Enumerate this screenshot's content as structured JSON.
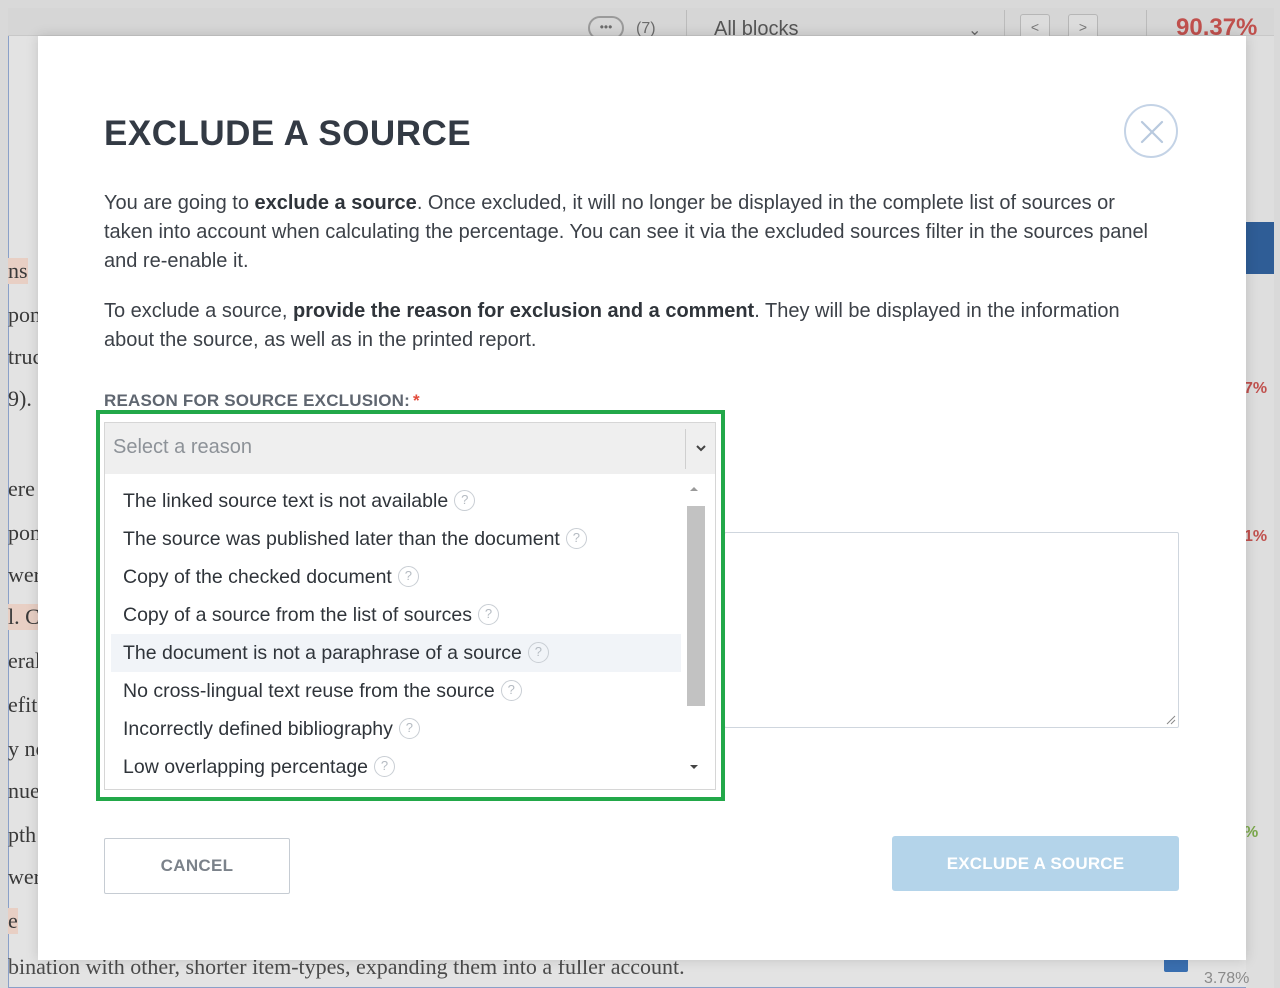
{
  "background": {
    "toolbar": {
      "more_label": "•••",
      "count": "(7)",
      "blocks_select": "All blocks",
      "prev_label": "<",
      "next_label": ">",
      "overall_percent": "90.37%"
    },
    "text_fragments": [
      "ns",
      "pon",
      "truc",
      "9).",
      "ere",
      "pon",
      "wer",
      "l. C",
      "eral",
      "efit",
      "y no",
      "nue",
      "pth",
      "wer",
      "e"
    ],
    "right_percents": [
      "7%",
      "1%",
      "%"
    ],
    "bottom_text": "bination with other, shorter item-types, expanding them into a fuller account.",
    "bottom_right_percent": "3.78%"
  },
  "modal": {
    "title": "EXCLUDE A SOURCE",
    "paragraph1": {
      "part1": "You are going to ",
      "bold": "exclude a source",
      "part2": ". Once excluded, it will no longer be displayed in the complete list of sources or taken into account when calculating the percentage. You can see it via the excluded sources filter in the sources panel and re-enable it."
    },
    "paragraph2": {
      "part1": "To exclude a source, ",
      "bold": "provide the reason for exclusion and a comment",
      "part2": ". They will be displayed in the information about the source, as well as in the printed report."
    },
    "reason_label": "REASON FOR SOURCE EXCLUSION:",
    "required_mark": "*",
    "select_placeholder": "Select a reason",
    "options": [
      "The linked source text is not available",
      "The source was published later than the document",
      "Copy of the checked document",
      "Copy of a source from the list of sources",
      "The document is not a paraphrase of a source",
      "No cross-lingual text reuse from the source",
      "Incorrectly defined bibliography",
      "Low overlapping percentage"
    ],
    "help_glyph": "?",
    "hovered_option_index": 4,
    "cancel_label": "CANCEL",
    "exclude_label": "EXCLUDE A SOURCE",
    "colors": {
      "highlight_border": "#22a849",
      "primary_disabled": "#b4d4ea",
      "required": "#e24b3b",
      "percent_red": "#c0504d"
    }
  }
}
